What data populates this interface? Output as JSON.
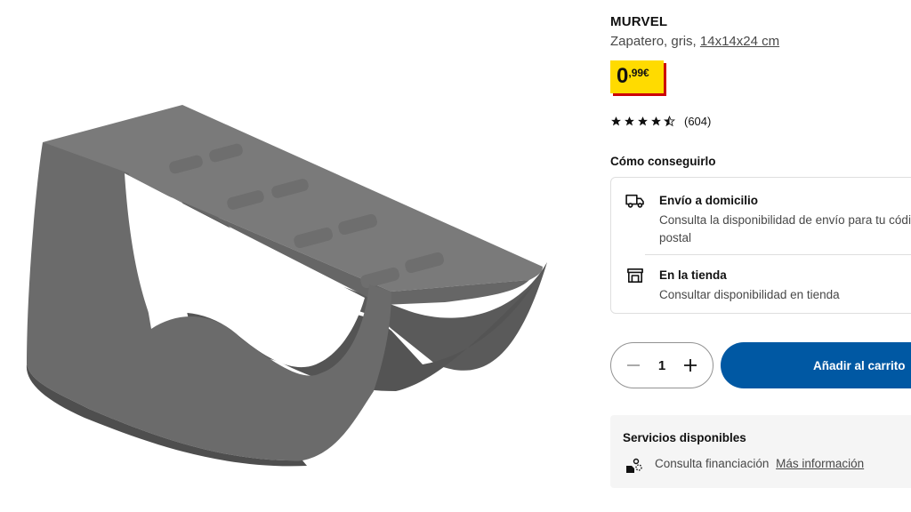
{
  "product": {
    "name": "MURVEL",
    "description": "Zapatero, gris,",
    "dimensions": "14x14x24 cm",
    "price_integer": "0",
    "price_decimal": ",99€",
    "rating": 4.5,
    "review_count": "(604)"
  },
  "availability": {
    "title": "Cómo conseguirlo",
    "delivery": {
      "icon": "truck-icon",
      "title": "Envío a domicilio",
      "text": "Consulta la disponibilidad de envío para tu código postal"
    },
    "store": {
      "icon": "store-icon",
      "title": "En la tienda",
      "text": "Consultar disponibilidad en tienda"
    }
  },
  "cart": {
    "quantity": "1",
    "add_label": "Añadir al carrito"
  },
  "services": {
    "title": "Servicios disponibles",
    "financing_icon": "financing-icon",
    "financing_text": "Consulta financiación",
    "financing_link": "Más información"
  },
  "colors": {
    "price_yellow": "#ffdb00",
    "price_red": "#cc0008",
    "primary_blue": "#0058a3",
    "product_gray": "#6b6b6b"
  }
}
